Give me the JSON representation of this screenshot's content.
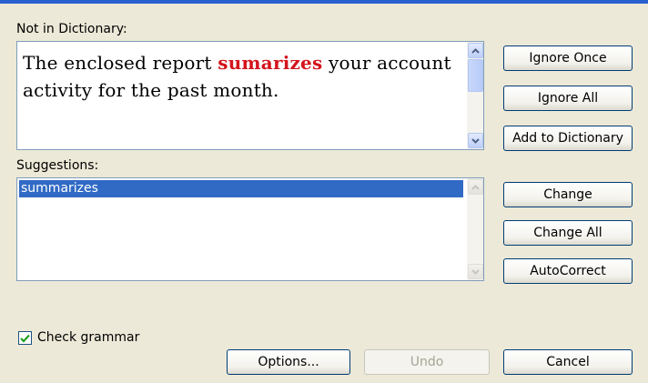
{
  "labels": {
    "not_in_dictionary": "Not in Dictionary:",
    "suggestions": "Suggestions:",
    "check_grammar": "Check grammar"
  },
  "sentence": {
    "before": "The enclosed report ",
    "misspelled": "sumarizes",
    "after": " your account activity for the past month."
  },
  "suggestions": [
    "summarizes"
  ],
  "buttons": {
    "ignore_once": "Ignore Once",
    "ignore_all": "Ignore All",
    "add_to_dictionary": "Add to Dictionary",
    "change": "Change",
    "change_all": "Change All",
    "autocorrect": "AutoCorrect",
    "options": "Options...",
    "undo": "Undo",
    "cancel": "Cancel"
  },
  "check_grammar_checked": true,
  "colors": {
    "misspelled": "#d4141c",
    "selection": "#316ac5",
    "dialog_bg": "#ece9d8"
  }
}
